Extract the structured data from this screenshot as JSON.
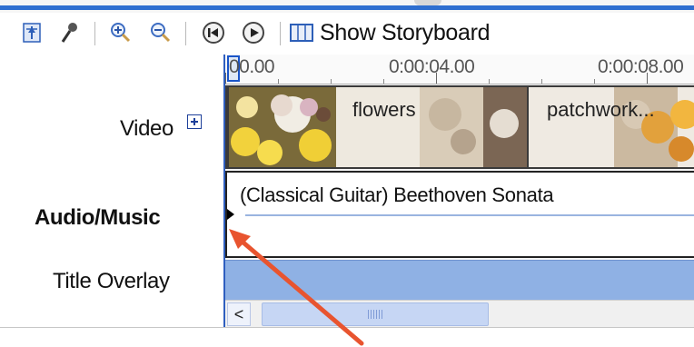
{
  "toolbar": {
    "show_storyboard_label": "Show Storyboard"
  },
  "tracks": {
    "video_label": "Video",
    "audio_label": "Audio/Music",
    "title_overlay_label": "Title Overlay"
  },
  "ruler": {
    "labels": [
      "00.00",
      "0:00:04.00",
      "0:00:08.00"
    ]
  },
  "video_clips": [
    {
      "title": "flowers"
    },
    {
      "title": "patchwork..."
    }
  ],
  "audio_clip": {
    "title": "(Classical Guitar) Beethoven Sonata"
  },
  "scrollbar": {
    "left_arrow": "<"
  },
  "colors": {
    "accent_blue": "#2f6fd0",
    "title_overlay_track": "#8fb1e4",
    "annotation_arrow": "#e8542f"
  },
  "icons": [
    "narrate-timeline-icon",
    "set-audio-levels-icon",
    "zoom-in-icon",
    "zoom-out-icon",
    "rewind-icon",
    "play-icon",
    "storyboard-icon",
    "expand-icon"
  ]
}
